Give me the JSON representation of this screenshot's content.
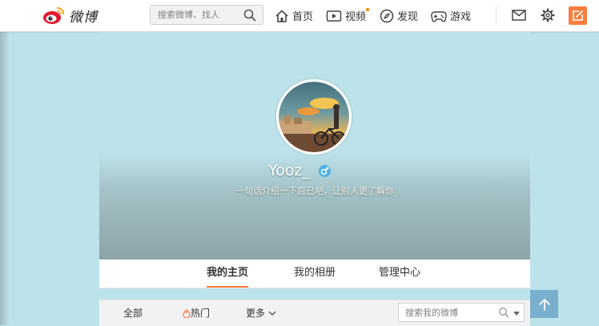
{
  "brand": {
    "logo_text": "微博"
  },
  "search": {
    "placeholder": "搜索微博、找人"
  },
  "nav": {
    "home": "首页",
    "video": "视频",
    "discover": "发现",
    "games": "游戏"
  },
  "profile": {
    "username": "Yooz_",
    "intro": "一句话介绍一下自己吧，让别人更了解你",
    "gender": "male"
  },
  "tabs": [
    {
      "label": "我的主页",
      "active": true
    },
    {
      "label": "我的相册",
      "active": false
    },
    {
      "label": "管理中心",
      "active": false
    }
  ],
  "feed_filters": {
    "all": "全部",
    "hot": "热门",
    "more": "更多"
  },
  "feed_search": {
    "placeholder": "搜索我的微博"
  },
  "colors": {
    "background": "#bde3ea",
    "accent": "#fa7d3c",
    "notify_dot": "#ff8200",
    "gender_male": "#4fb0e6",
    "back_to_top": "#7ab0cf"
  },
  "icons": [
    "weibo-logo-icon",
    "search-icon",
    "home-icon",
    "video-icon",
    "compass-icon",
    "gamepad-icon",
    "mail-icon",
    "gear-icon",
    "compose-icon",
    "male-icon",
    "flame-icon",
    "chevron-down-icon",
    "arrow-up-icon"
  ]
}
